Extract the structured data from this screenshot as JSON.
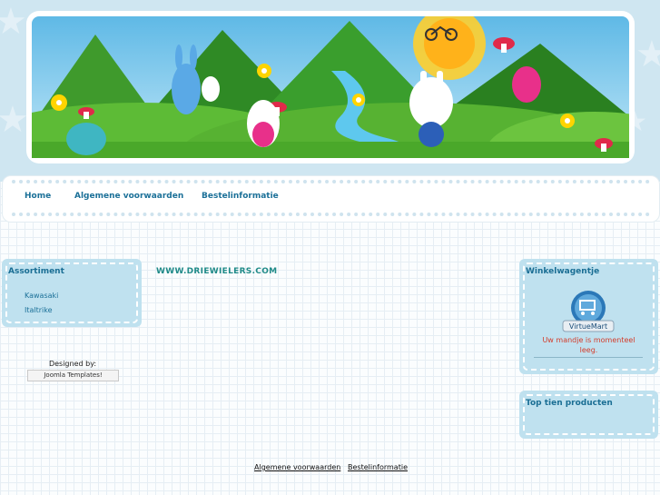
{
  "nav": {
    "items": [
      {
        "label": "Home"
      },
      {
        "label": "Algemene voorwaarden"
      },
      {
        "label": "Bestelinformatie"
      }
    ]
  },
  "sidebar_left": {
    "title": "Assortiment",
    "items": [
      {
        "label": "Kawasaki"
      },
      {
        "label": "Italtrike"
      }
    ],
    "designed_by": "Designed by:",
    "badge": "Joomla Templates!"
  },
  "main": {
    "site_url": "WWW.DRIEWIELERS.COM"
  },
  "sidebar_right": {
    "cart_title": "Winkelwagentje",
    "cart_logo": "VirtueMart",
    "cart_empty": "Uw mandje is momenteel leeg.",
    "top_title": "Top tien producten"
  },
  "footer": {
    "links": [
      {
        "label": "Algemene voorwaarden"
      },
      {
        "label": "Bestelinformatie"
      }
    ]
  },
  "colors": {
    "accent": "#1b7098",
    "title": "#1a6e94",
    "url": "#1f8a88",
    "cart_empty": "#d43c2a",
    "box": "#bfe1ef",
    "sky": "#cfe6f1"
  }
}
